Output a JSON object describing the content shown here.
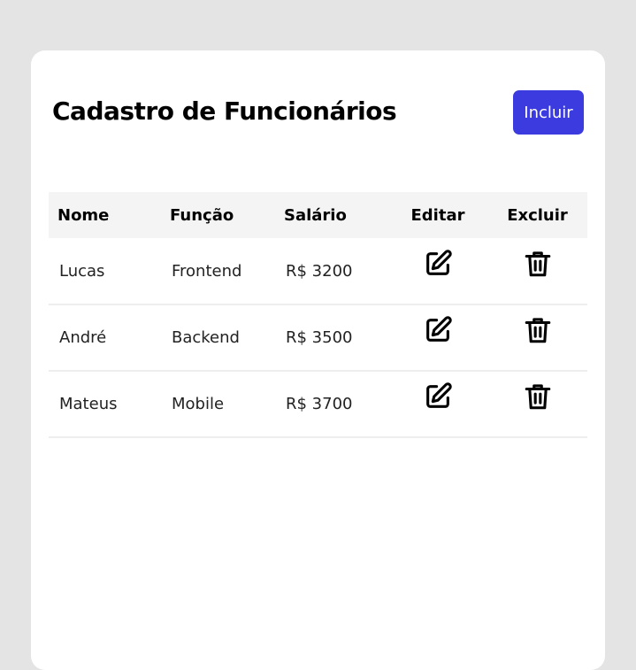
{
  "header": {
    "title": "Cadastro de Funcionários",
    "add_label": "Incluir"
  },
  "table": {
    "columns": [
      "Nome",
      "Função",
      "Salário",
      "Editar",
      "Excluir"
    ],
    "rows": [
      {
        "name": "Lucas",
        "role": "Frontend",
        "salary": "R$ 3200"
      },
      {
        "name": "André",
        "role": "Backend",
        "salary": "R$ 3500"
      },
      {
        "name": "Mateus",
        "role": "Mobile",
        "salary": "R$ 3700"
      }
    ],
    "edit_icon": "edit-icon",
    "delete_icon": "trash-icon"
  },
  "colors": {
    "accent": "#3b3be0",
    "background": "#e4e4e4",
    "card": "#ffffff",
    "header_row": "#f4f4f4"
  }
}
